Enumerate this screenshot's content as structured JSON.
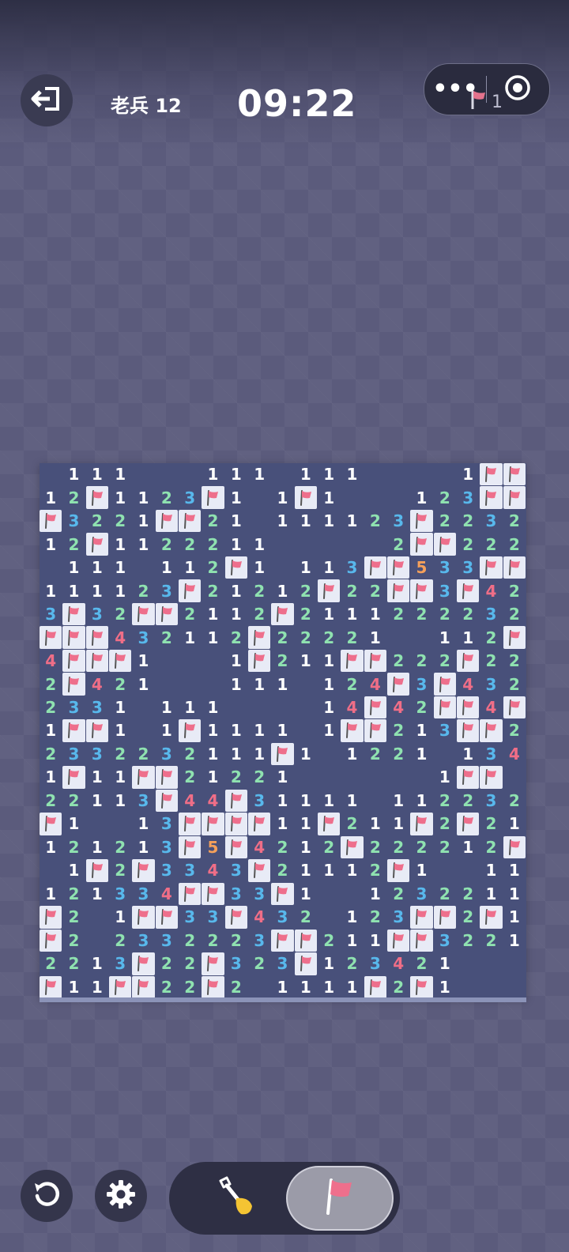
{
  "header": {
    "back_icon": "exit-arrow-icon",
    "level_label": "老兵 12",
    "timer": "09:22",
    "capsule_more": "•••",
    "capsule_record_icon": "target-icon",
    "flag_count": "1"
  },
  "board": {
    "cols": 21,
    "rows": 23,
    "legend": "F = flagged cell, . = empty revealed cell, # = unrevealed cell, digits = adjacent mine count",
    "rows_data": [
      ".111...111.111....1FF##",
      "12F112 3F1.1F1...123FFF",
      "F3221FF21.11112 3F2232",
      "12F11222 11.....2FF22232",
      ".111.112F1.113FF533FFF",
      "11112 3F212 12F22FF3F42",
      "3F32FF2112F2111222232",
      "FFF432112F22221..112FF",
      "4FFF1...1F211FF222F222",
      "2F421...111.124F3F4321",
      "233 1.111....14F42FF4F",
      "1FF1.1F1111.1FF213FF2",
      "2332232111F1.1221.1343",
      "1F11FF2122 1......1FF",
      "22113F44F31111.112232",
      "F1..13FFFF11F211F2F21",
      "12121 3F5F4212F22221 2F",
      ".1F2F334 3F21112F1..11",
      "121334FF33F1..12322 11",
      "F2.1FF33F432.123FF2F1",
      "F2.2332223FF211FF32211",
      "2213F22F323F1234 21..",
      "F11FF22F2.1111F2F1..."
    ]
  },
  "footer": {
    "undo_icon": "undo-icon",
    "settings_icon": "gear-icon",
    "dig_tool_icon": "shovel-icon",
    "flag_tool_icon": "flag-icon"
  },
  "colors": {
    "n1": "#ffffff",
    "n2": "#8fe2b0",
    "n3": "#58b8ec",
    "n4": "#f06e87",
    "n5": "#f5a05a",
    "flag": "#ee6f8c"
  }
}
